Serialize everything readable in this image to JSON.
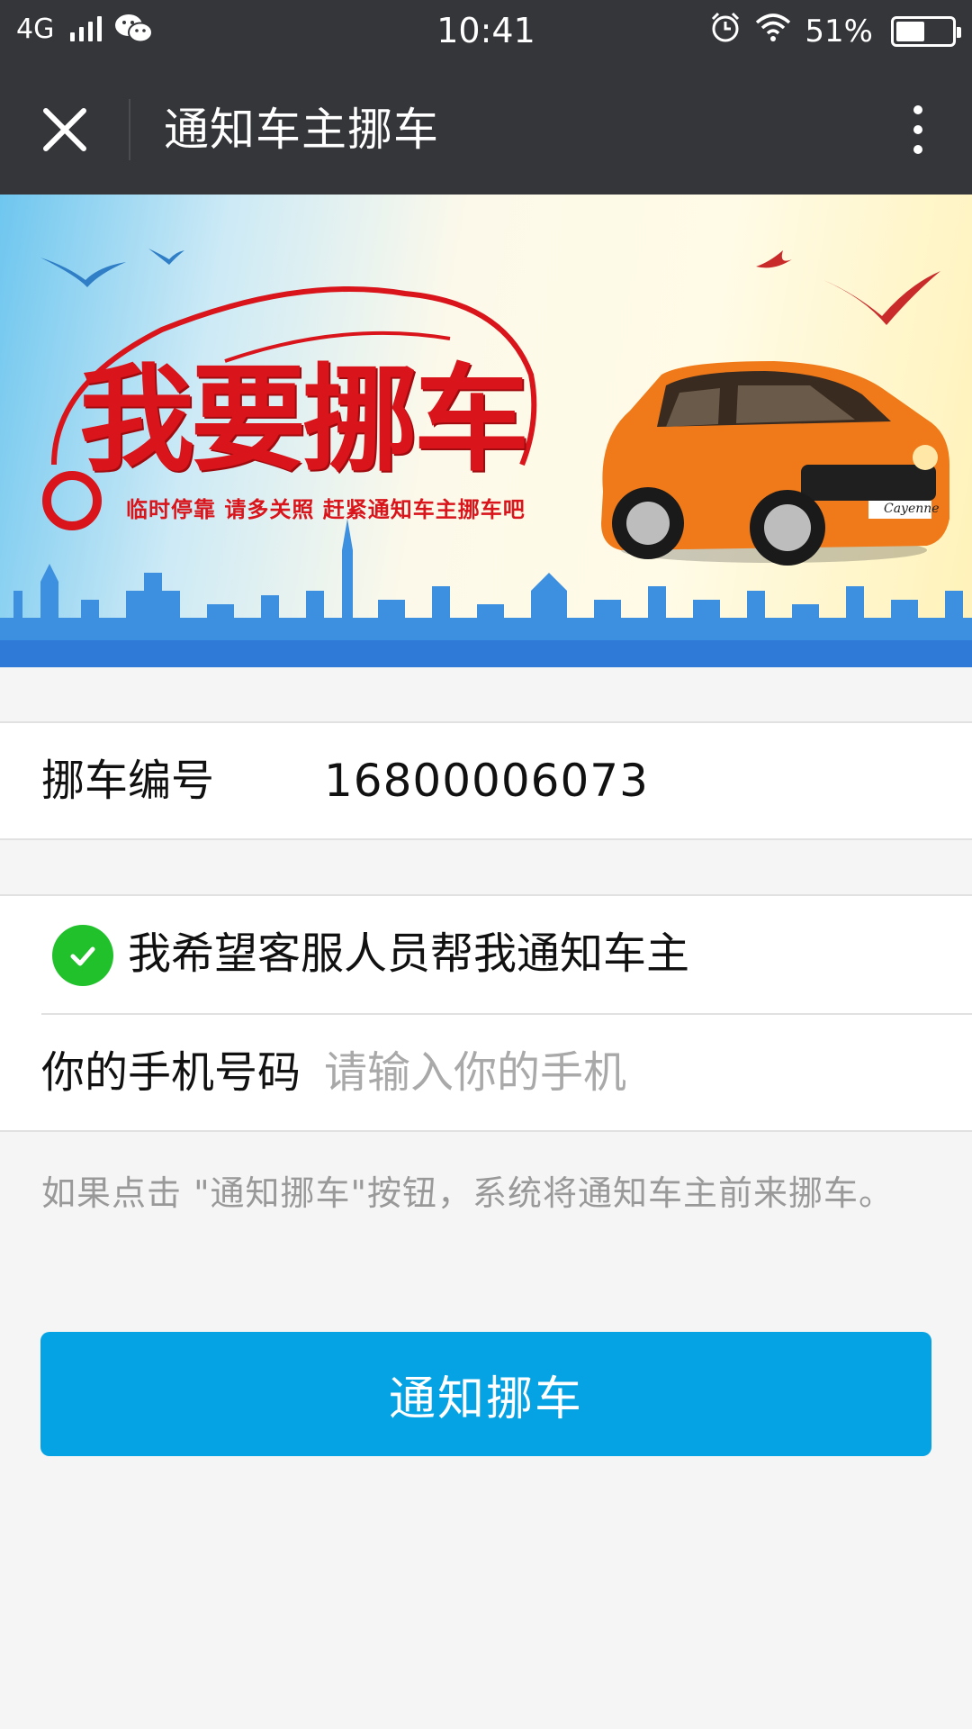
{
  "status_bar": {
    "network": "4G",
    "time": "10:41",
    "battery_percent": "51%",
    "battery_level": 0.51,
    "icons": [
      "signal-icon",
      "wechat-icon",
      "alarm-icon",
      "wifi-icon",
      "battery-icon"
    ]
  },
  "nav": {
    "title": "通知车主挪车",
    "close_icon": "close-icon",
    "more_icon": "more-vertical-icon"
  },
  "banner": {
    "title": "我要挪车",
    "subtitle": "临时停靠 请多关照 赶紧通知车主挪车吧",
    "car_badge": "Cayenne"
  },
  "form": {
    "code_label": "挪车编号",
    "code_value": "16800006073",
    "service_option": "我希望客服人员帮我通知车主",
    "service_checked": true,
    "phone_label": "你的手机号码",
    "phone_placeholder": "请输入你的手机",
    "phone_value": ""
  },
  "hint": "如果点击 \"通知挪车\"按钮，系统将通知车主前来挪车。",
  "button": {
    "label": "通知挪车"
  },
  "colors": {
    "header_bg": "#35363a",
    "page_bg": "#f5f5f5",
    "primary": "#05a3e4",
    "check_green": "#20c12b",
    "banner_red": "#d9141a"
  }
}
